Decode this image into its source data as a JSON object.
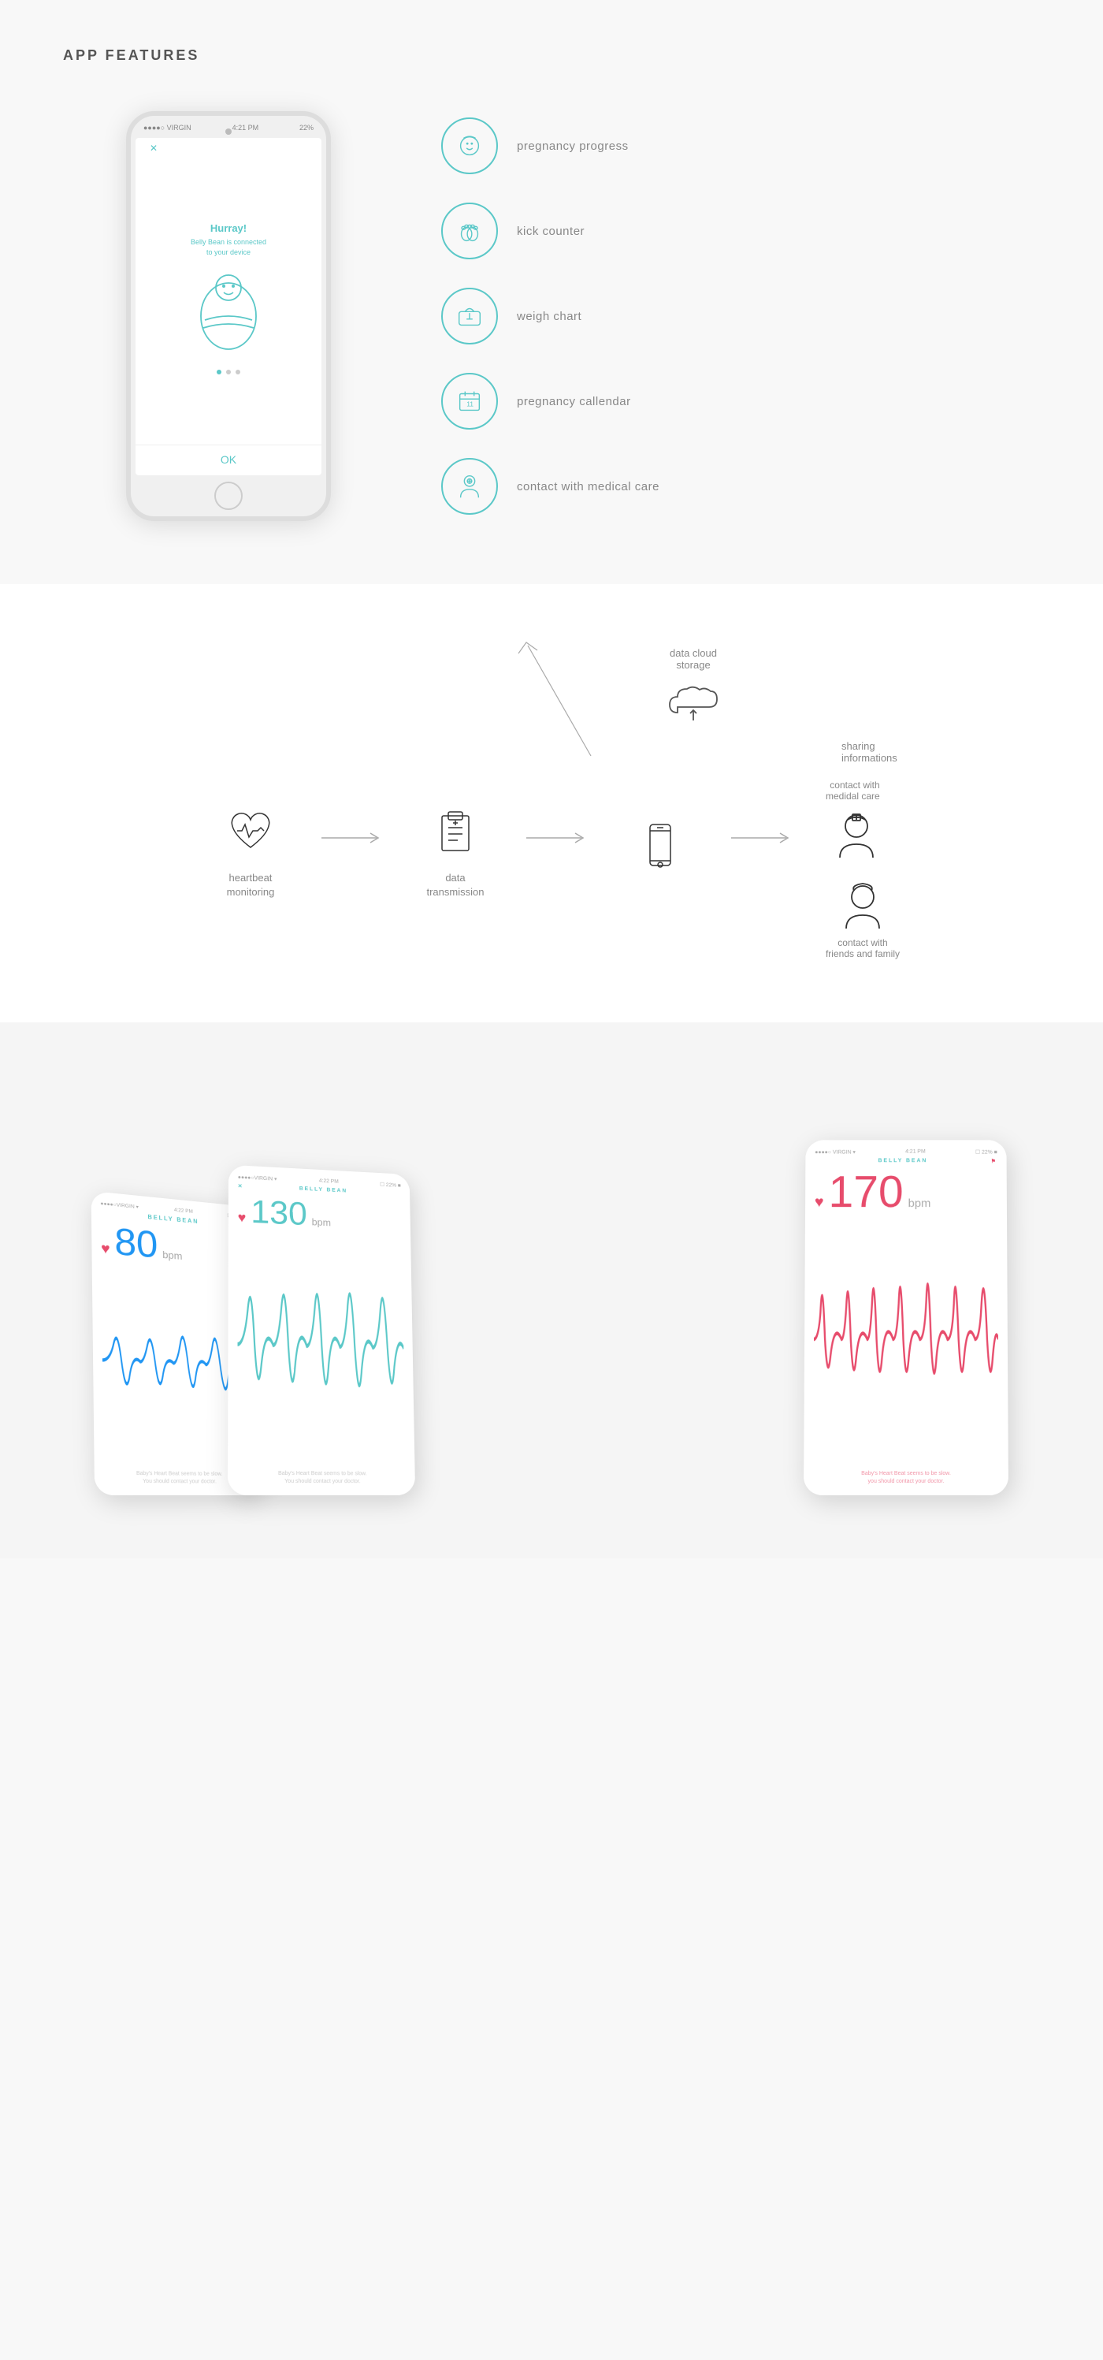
{
  "page": {
    "background": "#f8f8f8"
  },
  "section1": {
    "title": "APP FEATURES",
    "phone": {
      "carrier": "●●●●○ VIRGIN",
      "time": "4:21 PM",
      "battery": "22%",
      "hurray": "Hurray!",
      "sub": "Belly Bean is connected\nto your device",
      "ok": "OK"
    },
    "features": [
      {
        "id": "pregnancy-progress",
        "label": "pregnancy progress",
        "icon": "baby"
      },
      {
        "id": "kick-counter",
        "label": "kick counter",
        "icon": "feet"
      },
      {
        "id": "weigh-chart",
        "label": "weigh chart",
        "icon": "scale"
      },
      {
        "id": "pregnancy-calendar",
        "label": "pregnancy callendar",
        "icon": "calendar"
      },
      {
        "id": "contact-medical",
        "label": "contact with medical care",
        "icon": "doctor"
      }
    ]
  },
  "section2": {
    "nodes": [
      {
        "id": "heartbeat",
        "label": "heartbeat\nmonitoring",
        "icon": "heart-pulse"
      },
      {
        "id": "data-transmission",
        "label": "data\ntransmission",
        "icon": "clipboard"
      },
      {
        "id": "phone",
        "label": "",
        "icon": "phone"
      }
    ],
    "cloud": {
      "label": "data cloud\nstorage",
      "arrow_label": "sharing\ninformations"
    },
    "contacts": [
      {
        "id": "medical-care",
        "label": "contact with\nmedidal care",
        "icon": "nurse"
      },
      {
        "id": "friends-family",
        "label": "contact with\nfriends and family",
        "icon": "person"
      }
    ]
  },
  "section3": {
    "screens": [
      {
        "bpm": "80",
        "unit": "bpm",
        "color": "#2196F3",
        "brand": "BELLY BEAN",
        "footer": "Baby's Heart Beat seems to be slow.\nYou should contact your doctor."
      },
      {
        "bpm": "130",
        "unit": "bpm",
        "color": "#5bc8c8",
        "brand": "BELLY BEAN",
        "footer": "Baby's Heart Beat seems to be slow.\nYou should contact your doctor."
      },
      {
        "bpm": "170",
        "unit": "bpm",
        "color": "#e74c6c",
        "brand": "BELLY BEAN",
        "footer": "Baby's Heart Beat seems to be slow.\nyou should contact your doctor."
      }
    ]
  }
}
